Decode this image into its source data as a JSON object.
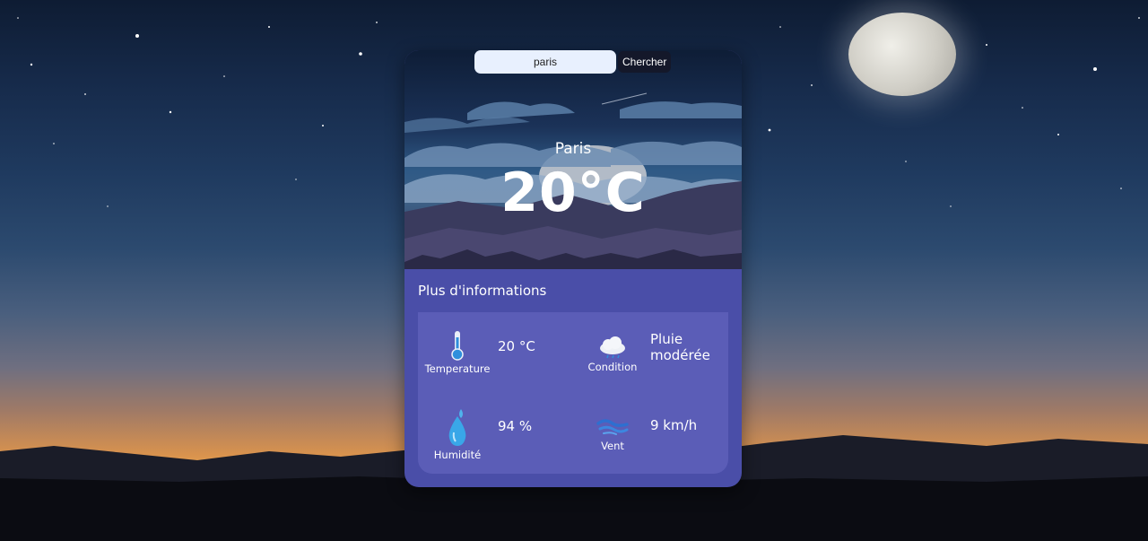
{
  "search": {
    "value": "paris",
    "button_label": "Chercher"
  },
  "weather": {
    "city": "Paris",
    "temperature": "20°C"
  },
  "info": {
    "title": "Plus d'informations",
    "temperature": {
      "label": "Temperature",
      "value": "20 °C"
    },
    "condition": {
      "label": "Condition",
      "value_line1": "Pluie",
      "value_line2": "modérée"
    },
    "humidity": {
      "label": "Humidité",
      "value": "94 %"
    },
    "wind": {
      "label": "Vent",
      "value": "9 km/h"
    }
  },
  "icons": {
    "temperature": "thermometer-icon",
    "condition": "cloud-rain-icon",
    "humidity": "water-drop-icon",
    "wind": "wind-icon"
  },
  "colors": {
    "card": "#4a4ea8",
    "panel": "#5b5db7",
    "search_field": "#e8f0fe",
    "search_button": "#14182a"
  }
}
